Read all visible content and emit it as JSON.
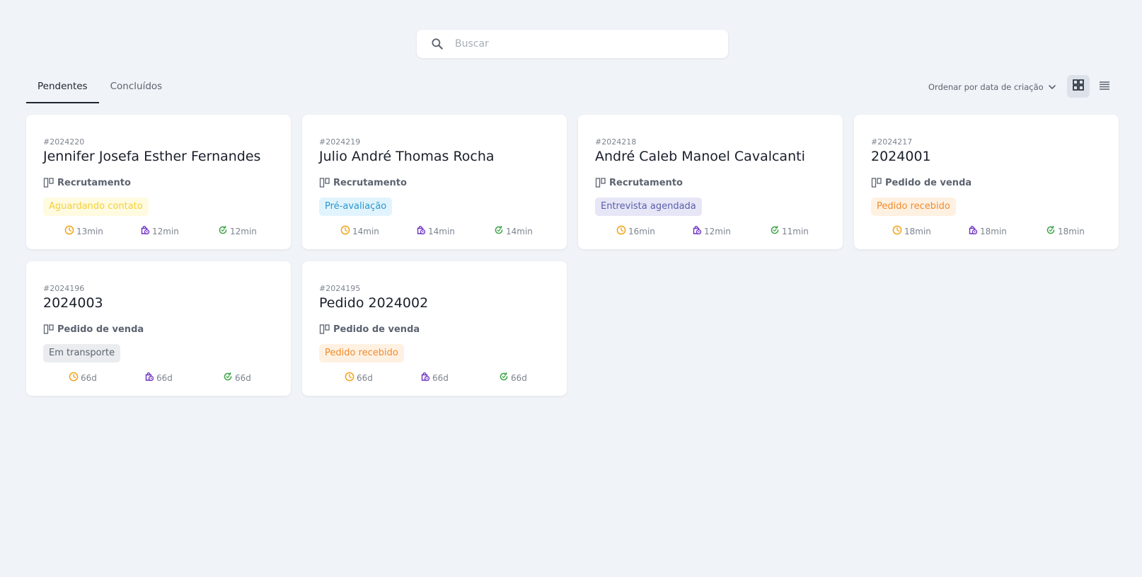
{
  "search": {
    "placeholder": "Buscar"
  },
  "tabs": [
    {
      "label": "Pendentes",
      "active": true
    },
    {
      "label": "Concluídos",
      "active": false
    }
  ],
  "sort": {
    "label": "Ordenar por data de criação"
  },
  "colors": {
    "clock": "#f3a31b",
    "bag": "#6b2fc7",
    "refresh": "#3fa64a"
  },
  "cards": [
    {
      "id": "#2024220",
      "title": "Jennifer Josefa Esther Fernandes",
      "type": "Recrutamento",
      "status": "Aguardando contato",
      "status_color": "yellow",
      "metrics": [
        "13min",
        "12min",
        "12min"
      ]
    },
    {
      "id": "#2024219",
      "title": "Julio André Thomas Rocha",
      "type": "Recrutamento",
      "status": "Pré-avaliação",
      "status_color": "blue",
      "metrics": [
        "14min",
        "14min",
        "14min"
      ]
    },
    {
      "id": "#2024218",
      "title": "André Caleb Manoel Cavalcanti",
      "type": "Recrutamento",
      "status": "Entrevista agendada",
      "status_color": "purple",
      "metrics": [
        "16min",
        "12min",
        "11min"
      ]
    },
    {
      "id": "#2024217",
      "title": "2024001",
      "type": "Pedido de venda",
      "status": "Pedido recebido",
      "status_color": "orange",
      "metrics": [
        "18min",
        "18min",
        "18min"
      ]
    },
    {
      "id": "#2024196",
      "title": "2024003",
      "type": "Pedido de venda",
      "status": "Em transporte",
      "status_color": "gray",
      "metrics": [
        "66d",
        "66d",
        "66d"
      ]
    },
    {
      "id": "#2024195",
      "title": "Pedido 2024002",
      "type": "Pedido de venda",
      "status": "Pedido recebido",
      "status_color": "orange",
      "metrics": [
        "66d",
        "66d",
        "66d"
      ]
    }
  ]
}
